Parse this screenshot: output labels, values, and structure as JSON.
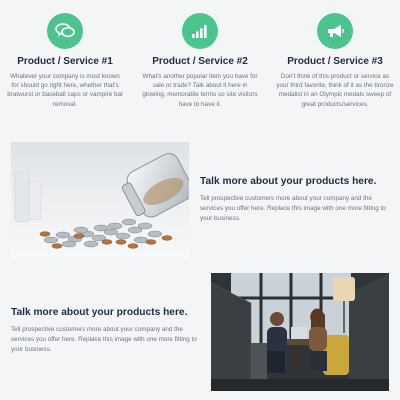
{
  "services": [
    {
      "icon": "chat-bubbles-icon",
      "title": "Product / Service #1",
      "description": "Whatever your company is most known for should go right here, whether that's bratwurst or baseball caps or vampire bat removal."
    },
    {
      "icon": "signal-bars-icon",
      "title": "Product / Service #2",
      "description": "What's another popular item you have for sale or trade? Talk about it here in glowing, memorable terms so site visitors have to have it."
    },
    {
      "icon": "megaphone-icon",
      "title": "Product / Service #3",
      "description": "Don't think of this product or service as your third favorite, think of it as the bronze medalist in an Olympic medals sweep of great products/services."
    }
  ],
  "feature1": {
    "heading": "Talk more about your products here.",
    "body": "Tell prospective customers more about your company and the services you offer here.  Replace this image with one more fitting to your business."
  },
  "feature2": {
    "heading": "Talk more about your products here.",
    "body": "Tell prospective customers more about your company and the services you offer here.  Replace this image with one more fitting to your business."
  },
  "colors": {
    "accent": "#4dc38d",
    "heading": "#1f2a44",
    "body_text": "#6b7380",
    "background": "#f4f5f7"
  }
}
